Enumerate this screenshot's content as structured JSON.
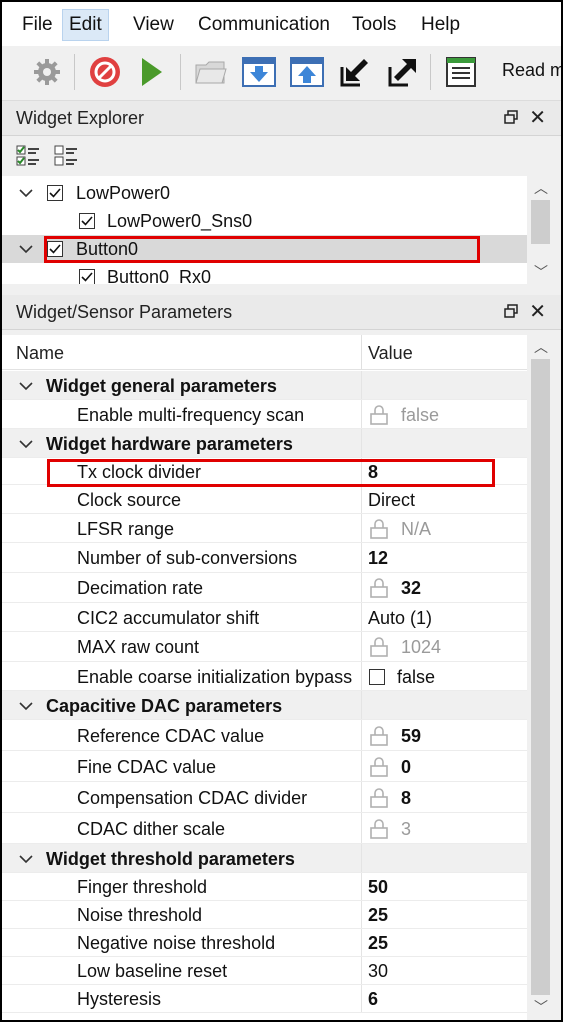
{
  "menu": [
    "File",
    "Edit",
    "View",
    "Communication",
    "Tools",
    "Help"
  ],
  "toolbar": {
    "truncated_label": "Read m"
  },
  "widget_explorer": {
    "title": "Widget Explorer",
    "tree": [
      {
        "label": "LowPower0",
        "level": 0,
        "checked": true,
        "expanded": true
      },
      {
        "label": "LowPower0_Sns0",
        "level": 1,
        "checked": true
      },
      {
        "label": "Button0",
        "level": 0,
        "checked": true,
        "expanded": true,
        "selected": true
      },
      {
        "label": "Button0_Rx0",
        "level": 1,
        "checked": true
      }
    ]
  },
  "params": {
    "title": "Widget/Sensor Parameters",
    "col_name": "Name",
    "col_value": "Value",
    "rows": [
      {
        "group": true,
        "name": "Widget general parameters"
      },
      {
        "name": "Enable multi-frequency scan",
        "value": "false",
        "lock": true,
        "readonly": true
      },
      {
        "group": true,
        "name": "Widget hardware parameters"
      },
      {
        "name": "Tx clock divider",
        "value": "8",
        "bold": true,
        "highlight": true
      },
      {
        "name": "Clock source",
        "value": "Direct"
      },
      {
        "name": "LFSR range",
        "value": "N/A",
        "lock": true,
        "readonly": true
      },
      {
        "name": "Number of sub-conversions",
        "value": "12",
        "bold": true
      },
      {
        "name": "Decimation rate",
        "value": "32",
        "lock": true,
        "bold": true
      },
      {
        "name": "CIC2 accumulator shift",
        "value": "Auto (1)"
      },
      {
        "name": "MAX raw count",
        "value": "1024",
        "lock": true,
        "readonly": true
      },
      {
        "name": "Enable coarse initialization bypass",
        "value": "false",
        "checkbox": true
      },
      {
        "group": true,
        "name": "Capacitive DAC parameters"
      },
      {
        "name": "Reference CDAC value",
        "value": "59",
        "lock": true,
        "bold": true
      },
      {
        "name": "Fine CDAC value",
        "value": "0",
        "lock": true,
        "bold": true
      },
      {
        "name": "Compensation CDAC divider",
        "value": "8",
        "lock": true,
        "bold": true
      },
      {
        "name": "CDAC dither scale",
        "value": "3",
        "lock": true,
        "readonly": true
      },
      {
        "group": true,
        "name": "Widget threshold parameters"
      },
      {
        "name": "Finger threshold",
        "value": "50",
        "bold": true
      },
      {
        "name": "Noise threshold",
        "value": "25",
        "bold": true
      },
      {
        "name": "Negative noise threshold",
        "value": "25",
        "bold": true
      },
      {
        "name": "Low baseline reset",
        "value": "30"
      },
      {
        "name": "Hysteresis",
        "value": "6",
        "bold": true
      }
    ]
  }
}
